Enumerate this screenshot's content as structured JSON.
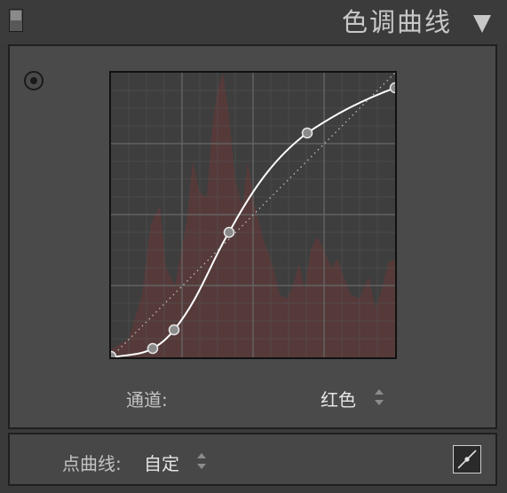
{
  "header": {
    "title": "色调曲线",
    "collapse_icon": "triangle-down-icon",
    "toggle_icon": "panel-switch-icon"
  },
  "tool": {
    "target_icon": "target-adjust-icon"
  },
  "curve": {
    "channel_color": "#ffffff",
    "histogram_color": "#5a3a3a"
  },
  "channel": {
    "label": "通道:",
    "value": "红色"
  },
  "point_curve": {
    "label": "点曲线:",
    "value": "自定",
    "edit_icon": "edit-point-curve-icon"
  }
}
